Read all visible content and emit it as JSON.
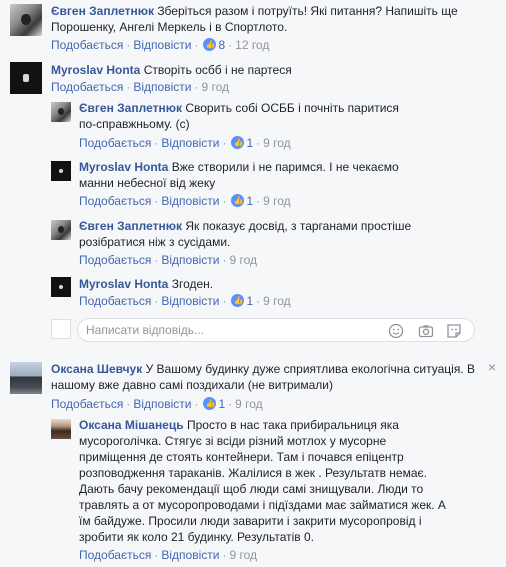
{
  "comments": [
    {
      "author": "Євген Заплетнюк",
      "text": "Зберіться разом і потруїть! Які питання? Напишіть ще Порошенку, Ангелі Меркель і в Спортлото.",
      "like": "Подобається",
      "reply": "Відповісти",
      "reactions": "8",
      "time": "12 год"
    },
    {
      "author": "Myroslav Honta",
      "text": "Створіть осбб і не партеся",
      "like": "Подобається",
      "reply": "Відповісти",
      "time": "9 год"
    }
  ],
  "replies_1": [
    {
      "author": "Євген Заплетнюк",
      "text": "Сворить собі ОСББ і почніть паритися по-справжньому. (с)",
      "like": "Подобається",
      "reply": "Відповісти",
      "reactions": "1",
      "time": "9 год"
    },
    {
      "author": "Myroslav Honta",
      "text": "Вже створили і не паримся. І не чекаємо манни небесної від жеку",
      "like": "Подобається",
      "reply": "Відповісти",
      "reactions": "1",
      "time": "9 год"
    },
    {
      "author": "Євген Заплетнюк",
      "text": "Як показує досвід, з тарганами простіше розібратися ніж з сусідами.",
      "like": "Подобається",
      "reply": "Відповісти",
      "time": "9 год"
    },
    {
      "author": "Myroslav Honta",
      "text": "Згоден.",
      "like": "Подобається",
      "reply": "Відповісти",
      "reactions": "1",
      "time": "9 год"
    }
  ],
  "reply_input": {
    "placeholder": "Написати відповідь..."
  },
  "comment_3": {
    "author": "Оксана Шевчук",
    "text": "У Вашому будинку дуже сприятлива екологічна ситуація. В нашому вже давно самі поздихали (не витримали)",
    "like": "Подобається",
    "reply": "Відповісти",
    "reactions": "1",
    "time": "9 год",
    "close": "×"
  },
  "reply_3": {
    "author": "Оксана Мішанець",
    "text": "Просто в нас така прибиральниця яка мусороголічка. Стягує зі всіди різний мотлох у мусорне приміщення де стоять контейнери. Там і почався епіцентр розповодження тараканів. Жалілися в жек . Результатв немає. Дають бачу рекомендації щоб люди самі знищували. Люди то травлять а от мусоропроводами і підїздами має займатися жек. А їм байдуже. Просили люди заварити і закрити мусоропровід і зробити як коло 21 будинку. Результатів 0.",
    "like": "Подобається",
    "reply": "Відповісти",
    "time": "9 год"
  },
  "separator": "·"
}
